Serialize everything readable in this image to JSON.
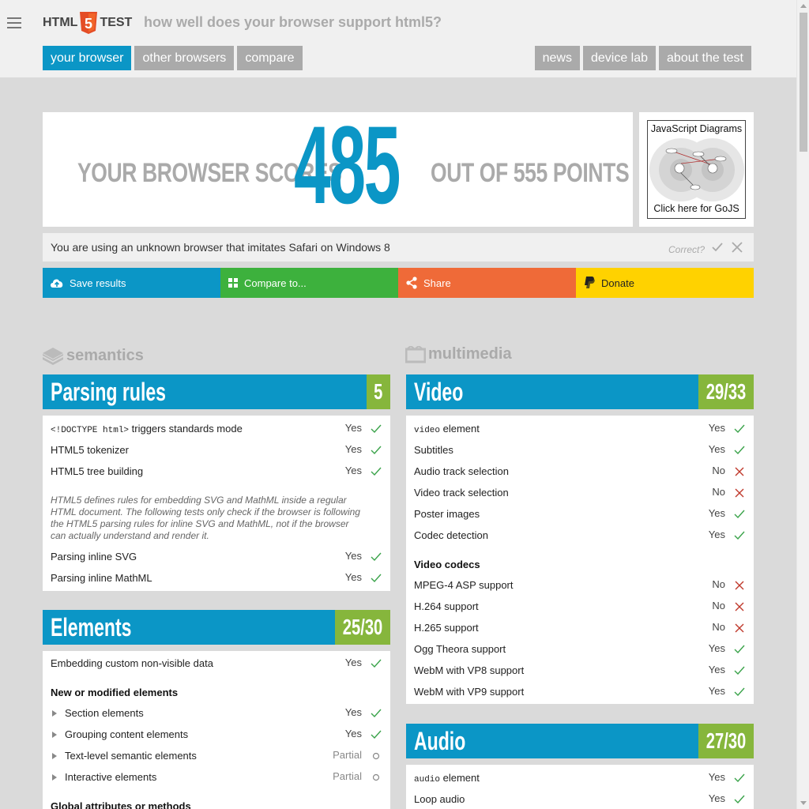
{
  "header": {
    "logo_left": "HTML",
    "logo_shield": "5",
    "logo_right": "TEST",
    "tagline": "how well does your browser support html5?",
    "tabs_left": [
      {
        "label": "your browser",
        "active": true
      },
      {
        "label": "other browsers",
        "active": false
      },
      {
        "label": "compare",
        "active": false
      }
    ],
    "tabs_right": [
      {
        "label": "news"
      },
      {
        "label": "device lab"
      },
      {
        "label": "about the test"
      }
    ],
    "menu_icon": "hamburger-icon"
  },
  "score": {
    "prefix": "YOUR BROWSER SCORES",
    "value": "485",
    "suffix": "OUT OF 555 POINTS"
  },
  "ad": {
    "title": "JavaScript Diagrams",
    "caption": "Click here for GoJS"
  },
  "ua": {
    "text": "You are using an unknown browser that imitates Safari on Windows 8",
    "correct_label": "Correct?"
  },
  "actions": [
    {
      "label": "Save results",
      "icon": "cloud-upload-icon",
      "color": "#0b96c6"
    },
    {
      "label": "Compare to...",
      "icon": "grid-icon",
      "color": "#3db13d"
    },
    {
      "label": "Share",
      "icon": "share-icon",
      "color": "#ef6a38"
    },
    {
      "label": "Donate",
      "icon": "paypal-icon",
      "color": "#ffd200"
    }
  ],
  "categories": {
    "semantics": "semantics",
    "multimedia": "multimedia"
  },
  "parsing": {
    "title": "Parsing rules",
    "score": "5",
    "rows": [
      {
        "code": "<!DOCTYPE html>",
        "label": " triggers standards mode",
        "result": "Yes"
      },
      {
        "label": "HTML5 tokenizer",
        "result": "Yes"
      },
      {
        "label": "HTML5 tree building",
        "result": "Yes"
      },
      {
        "label": "Parsing inline SVG",
        "result": "Yes"
      },
      {
        "label": "Parsing inline MathML",
        "result": "Yes"
      }
    ],
    "note": "HTML5 defines rules for embedding SVG and MathML inside a regular HTML document. The following tests only check if the browser is following the HTML5 parsing rules for inline SVG and MathML, not if the browser can actually understand and render it."
  },
  "elements": {
    "title": "Elements",
    "score": "25/30",
    "rows": [
      {
        "label": "Embedding custom non-visible data",
        "result": "Yes"
      }
    ],
    "subhead": "New or modified elements",
    "nested": [
      {
        "label": "Section elements",
        "result": "Yes"
      },
      {
        "label": "Grouping content elements",
        "result": "Yes"
      },
      {
        "label": "Text-level semantic elements",
        "result": "Partial"
      },
      {
        "label": "Interactive elements",
        "result": "Partial"
      }
    ],
    "subhead2": "Global attributes or methods"
  },
  "video": {
    "title": "Video",
    "score": "29/33",
    "rows": [
      {
        "code": "video",
        "label": " element",
        "result": "Yes"
      },
      {
        "label": "Subtitles",
        "result": "Yes"
      },
      {
        "label": "Audio track selection",
        "result": "No"
      },
      {
        "label": "Video track selection",
        "result": "No"
      },
      {
        "label": "Poster images",
        "result": "Yes"
      },
      {
        "label": "Codec detection",
        "result": "Yes"
      }
    ],
    "subhead": "Video codecs",
    "codecs": [
      {
        "label": "MPEG-4 ASP support",
        "result": "No"
      },
      {
        "label": "H.264 support",
        "result": "No"
      },
      {
        "label": "H.265 support",
        "result": "No"
      },
      {
        "label": "Ogg Theora support",
        "result": "Yes"
      },
      {
        "label": "WebM with VP8 support",
        "result": "Yes"
      },
      {
        "label": "WebM with VP9 support",
        "result": "Yes"
      }
    ]
  },
  "audio": {
    "title": "Audio",
    "score": "27/30",
    "rows": [
      {
        "code": "audio",
        "label": " element",
        "result": "Yes"
      },
      {
        "label": "Loop audio",
        "result": "Yes"
      }
    ]
  },
  "colors": {
    "accent": "#0b96c6",
    "score_green": "#86b63c",
    "yes": "#3aa34a",
    "no": "#c0392b",
    "partial": "#888888"
  }
}
